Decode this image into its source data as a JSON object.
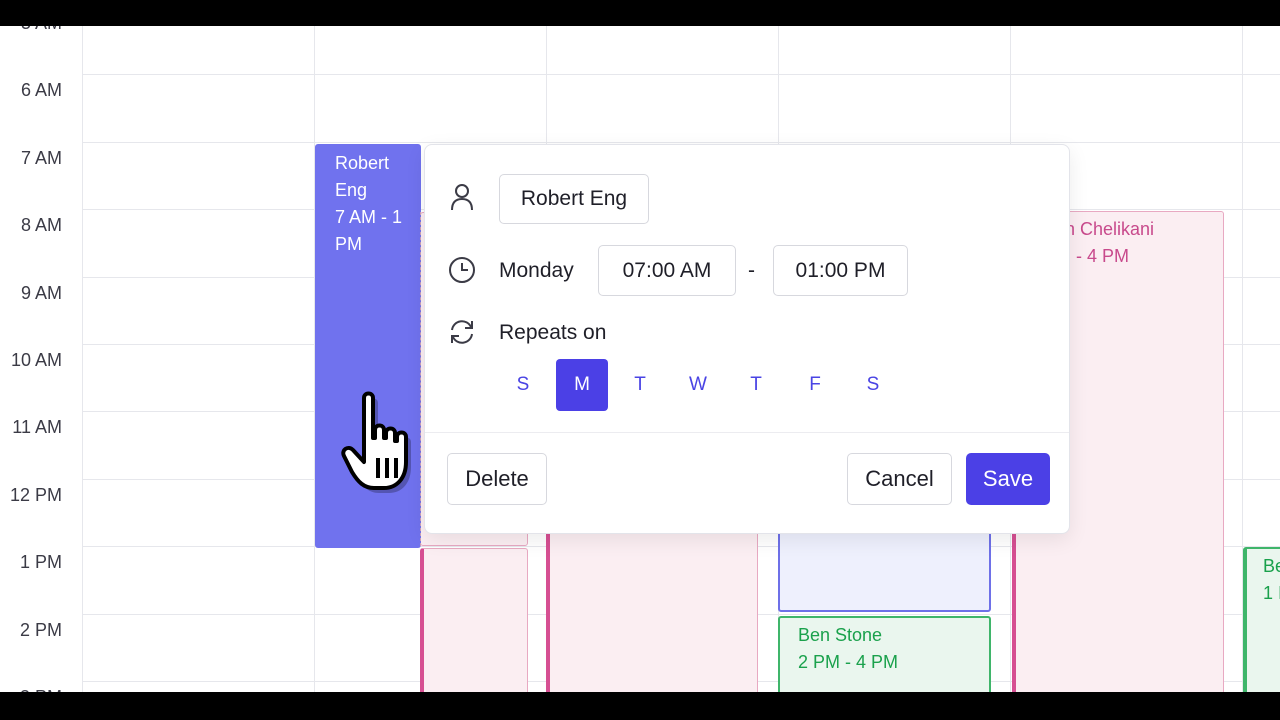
{
  "time_labels": [
    "6 AM",
    "7 AM",
    "8 AM",
    "9 AM",
    "10 AM",
    "11 AM",
    "12 PM",
    "1 PM",
    "2 PM"
  ],
  "events": {
    "robert": {
      "name": "Robert Eng",
      "time": "7 AM - 1 PM"
    },
    "chelikani": {
      "name": "ith Chelikani",
      "time": "M - 4 PM"
    },
    "ben": {
      "name": "Ben Stone",
      "time": "2 PM - 4 PM"
    },
    "partial_right": {
      "name": "Be",
      "time": "1 I"
    }
  },
  "popup": {
    "person": "Robert Eng",
    "day": "Monday",
    "start_time": "07:00 AM",
    "separator": "-",
    "end_time": "01:00 PM",
    "repeats_label": "Repeats on",
    "days": [
      "S",
      "M",
      "T",
      "W",
      "T",
      "F",
      "S"
    ],
    "active_day": "M",
    "delete_label": "Delete",
    "cancel_label": "Cancel",
    "save_label": "Save"
  },
  "colors": {
    "primary": "#4b40e6",
    "robert_event": "#7072ee",
    "pink_event": "#d64f92",
    "green_event": "#3fb56a"
  },
  "icons": [
    "person-icon",
    "clock-icon",
    "repeat-icon",
    "hand-cursor-icon"
  ]
}
